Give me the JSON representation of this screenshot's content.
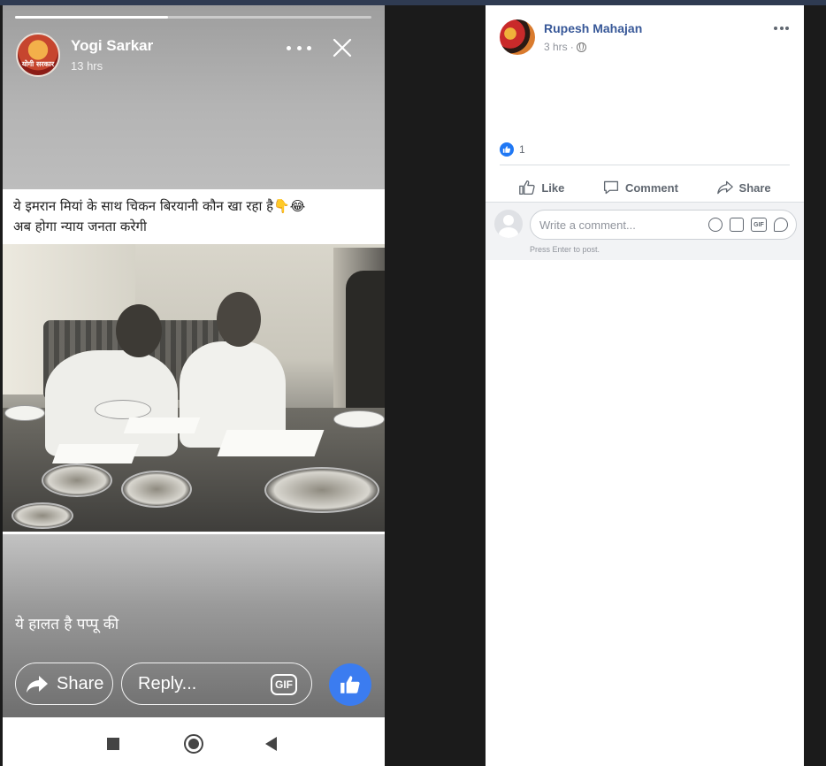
{
  "story": {
    "progress_fraction": 0.43,
    "author": "Yogi Sarkar",
    "avatar_text": "योगी सरकार",
    "time": "13 hrs",
    "caption_line1": "ये इमरान मियां के साथ चिकन बिरयानी कौन खा रहा है👇😂",
    "caption_line2": "अब होगा न्याय जनता करेगी",
    "bottom_caption": "ये हालत है पप्पू की",
    "share_label": "Share",
    "reply_placeholder": "Reply...",
    "gif_label": "GIF"
  },
  "post": {
    "author": "Rupesh Mahajan",
    "time": "3 hrs",
    "meta_separator": "·",
    "reaction_count": "1",
    "actions": {
      "like": "Like",
      "comment": "Comment",
      "share": "Share"
    },
    "comment_placeholder": "Write a comment...",
    "gif_label": "GIF",
    "press_enter_hint": "Press Enter to post."
  },
  "colors": {
    "fb_link": "#385898",
    "like_blue": "#3b7cf0",
    "secondary_text": "#606770"
  }
}
